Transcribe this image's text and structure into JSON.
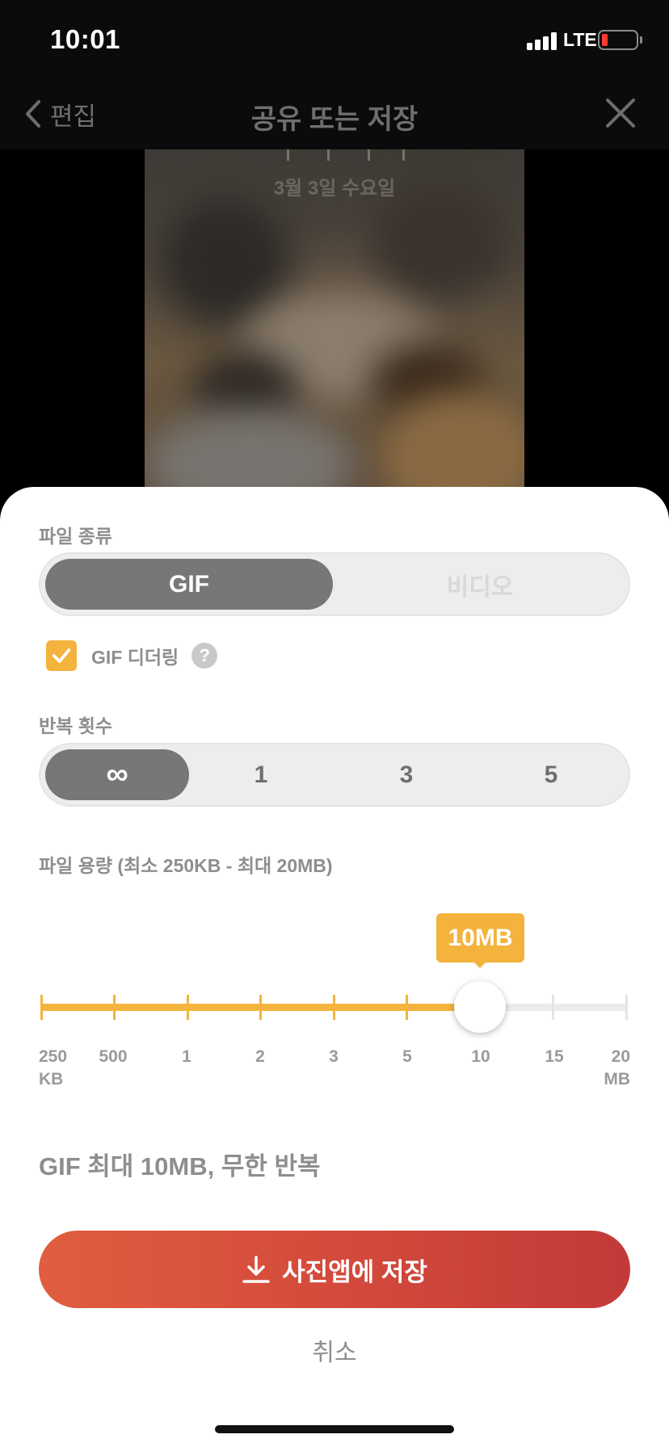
{
  "status_bar": {
    "time": "10:01",
    "network": "LTE"
  },
  "nav": {
    "back_label": "편집",
    "title": "공유 또는 저장"
  },
  "preview": {
    "date_text": "3월 3일 수요일"
  },
  "file_type": {
    "label": "파일 종류",
    "options": [
      "GIF",
      "비디오"
    ],
    "selected": "GIF"
  },
  "dithering": {
    "label": "GIF 디더링",
    "checked": true,
    "help": "?"
  },
  "repeat": {
    "label": "반복 횟수",
    "options": [
      "∞",
      "1",
      "3",
      "5"
    ],
    "selected": "∞"
  },
  "file_size": {
    "label": "파일 용량 (최소 250KB - 최대 20MB)",
    "value_label": "10MB",
    "tick_labels": [
      {
        "top": "250",
        "bottom": "KB"
      },
      {
        "top": "500",
        "bottom": ""
      },
      {
        "top": "1",
        "bottom": ""
      },
      {
        "top": "2",
        "bottom": ""
      },
      {
        "top": "3",
        "bottom": ""
      },
      {
        "top": "5",
        "bottom": ""
      },
      {
        "top": "10",
        "bottom": ""
      },
      {
        "top": "15",
        "bottom": ""
      },
      {
        "top": "20",
        "bottom": "MB"
      }
    ],
    "selected_index": 6
  },
  "summary": "GIF 최대 10MB, 무한 반복",
  "save_button": {
    "label": "사진앱에 저장"
  },
  "cancel_label": "취소",
  "colors": {
    "accent": "#f4b33d",
    "save_start": "#e05e3f",
    "save_end": "#c23a38",
    "segment_active": "#777777"
  }
}
